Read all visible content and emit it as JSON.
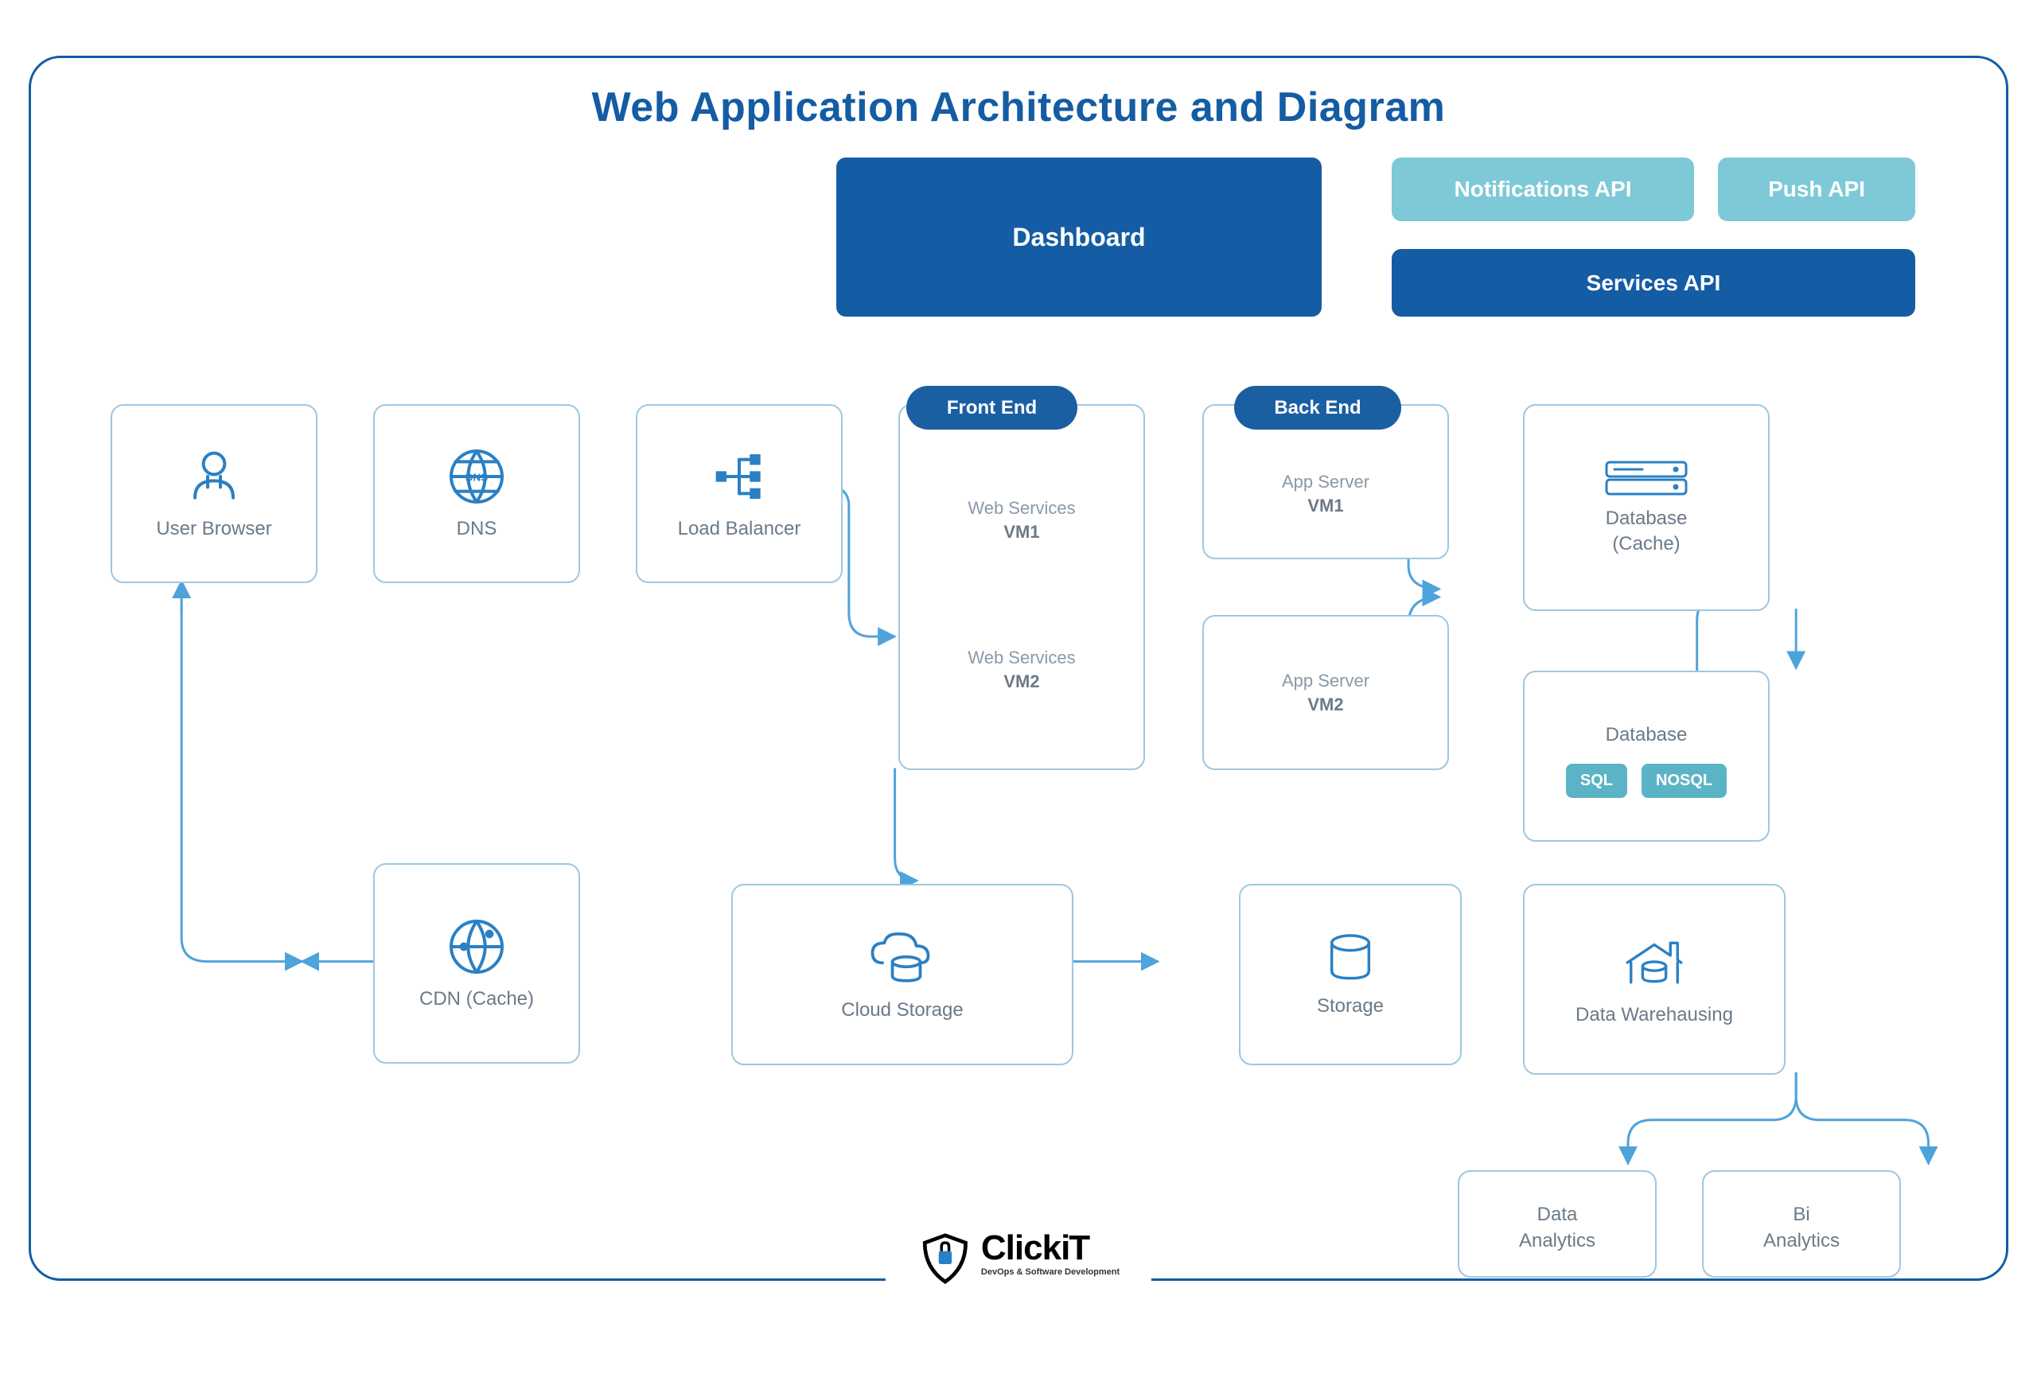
{
  "title": "Web Application Architecture and Diagram",
  "top": {
    "dashboard": "Dashboard",
    "notifications": "Notifications API",
    "push": "Push API",
    "services": "Services API"
  },
  "pills": {
    "frontend": "Front End",
    "backend": "Back End"
  },
  "nodes": {
    "user_browser": "User Browser",
    "dns": "DNS",
    "load_balancer": "Load Balancer",
    "web_services1_a": "Web Services",
    "web_services1_b": "VM1",
    "web_services2_a": "Web Services",
    "web_services2_b": "VM2",
    "app_server1_a": "App Server",
    "app_server1_b": "VM1",
    "app_server2_a": "App Server",
    "app_server2_b": "VM2",
    "db_cache_a": "Database",
    "db_cache_b": "(Cache)",
    "database": "Database",
    "sql": "SQL",
    "nosql": "NOSQL",
    "cdn": "CDN (Cache)",
    "cloud_storage": "Cloud Storage",
    "storage": "Storage",
    "data_warehousing": "Data Warehausing",
    "data_analytics_a": "Data",
    "data_analytics_b": "Analytics",
    "bi_analytics_a": "Bi",
    "bi_analytics_b": "Analytics"
  },
  "logo": {
    "name": "ClickiT",
    "tagline": "DevOps & Software Development"
  }
}
